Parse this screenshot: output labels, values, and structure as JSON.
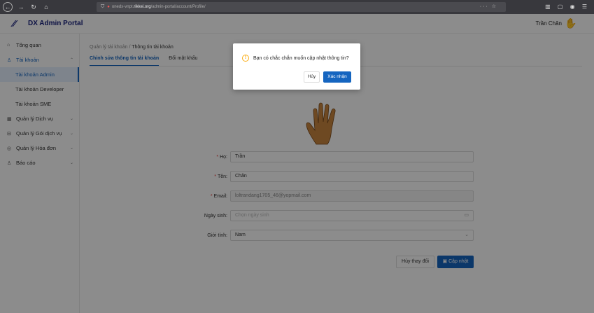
{
  "browser": {
    "url_host": "rikkei.org",
    "url_prefix": "onedx-vnpt.",
    "url_path": "/admin-portal/account/Profile/"
  },
  "header": {
    "brand": "DX Admin Portal",
    "user_name": "Trần Chân"
  },
  "sidebar": {
    "items": [
      {
        "label": "Tổng quan",
        "icon": "home-icon"
      },
      {
        "label": "Tài khoản",
        "icon": "user-icon"
      },
      {
        "label": "Tài khoản Admin"
      },
      {
        "label": "Tài khoản Developer"
      },
      {
        "label": "Tài khoản SME"
      },
      {
        "label": "Quản lý Dịch vụ",
        "icon": "grid-icon"
      },
      {
        "label": "Quản lý Gói dịch vụ",
        "icon": "package-icon"
      },
      {
        "label": "Quản lý Hóa đơn",
        "icon": "invoice-icon"
      },
      {
        "label": "Báo cáo",
        "icon": "report-icon"
      }
    ]
  },
  "breadcrumb": {
    "parent": "Quản lý tài khoản",
    "separator": "/",
    "current": "Thông tin tài khoản"
  },
  "tabs": [
    {
      "label": "Chỉnh sửa thông tin tài khoản",
      "active": true
    },
    {
      "label": "Đổi mật khẩu",
      "active": false
    }
  ],
  "form": {
    "last_name": {
      "label": "Họ:",
      "value": "Trần"
    },
    "first_name": {
      "label": "Tên:",
      "value": "Chân"
    },
    "email": {
      "label": "Email:",
      "value": "loltrandang1705_46@yopmail.com"
    },
    "birthday": {
      "label": "Ngày sinh:",
      "placeholder": "Chọn ngày sinh"
    },
    "gender": {
      "label": "Giới tính:",
      "value": "Nam"
    }
  },
  "actions": {
    "cancel_label": "Hủy thay đổi",
    "update_label": "Cập nhật"
  },
  "modal": {
    "message": "Bạn có chắc chắn muốn cập nhật thông tin?",
    "cancel_label": "Hủy",
    "confirm_label": "Xác nhận"
  },
  "colors": {
    "primary": "#1565c0",
    "brand": "#1a237e",
    "warning": "#faad14",
    "required": "#e53935"
  }
}
